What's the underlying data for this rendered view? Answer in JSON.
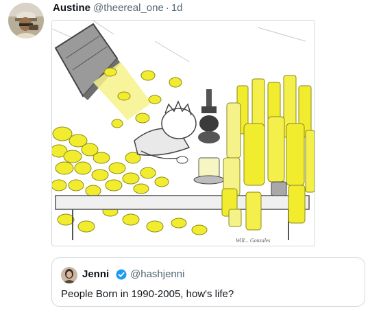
{
  "tweet": {
    "author_name": "Austine",
    "author_handle": "@theereal_one",
    "separator": "·",
    "timestamp": "1d"
  },
  "media": {
    "subject": "cartoon: person slumped on table while lemons pour from a chute and bottles of lemonade fill the room",
    "signature": "Will... Gonzales"
  },
  "quote": {
    "author_name": "Jenni",
    "author_handle": "@hashjenni",
    "text": "People Born in 1990-2005, how's life?"
  },
  "colors": {
    "handle_gray": "#536471",
    "border": "#cfd9de",
    "verified_blue": "#1d9bf0",
    "lemon_yellow": "#f2ec2e"
  }
}
